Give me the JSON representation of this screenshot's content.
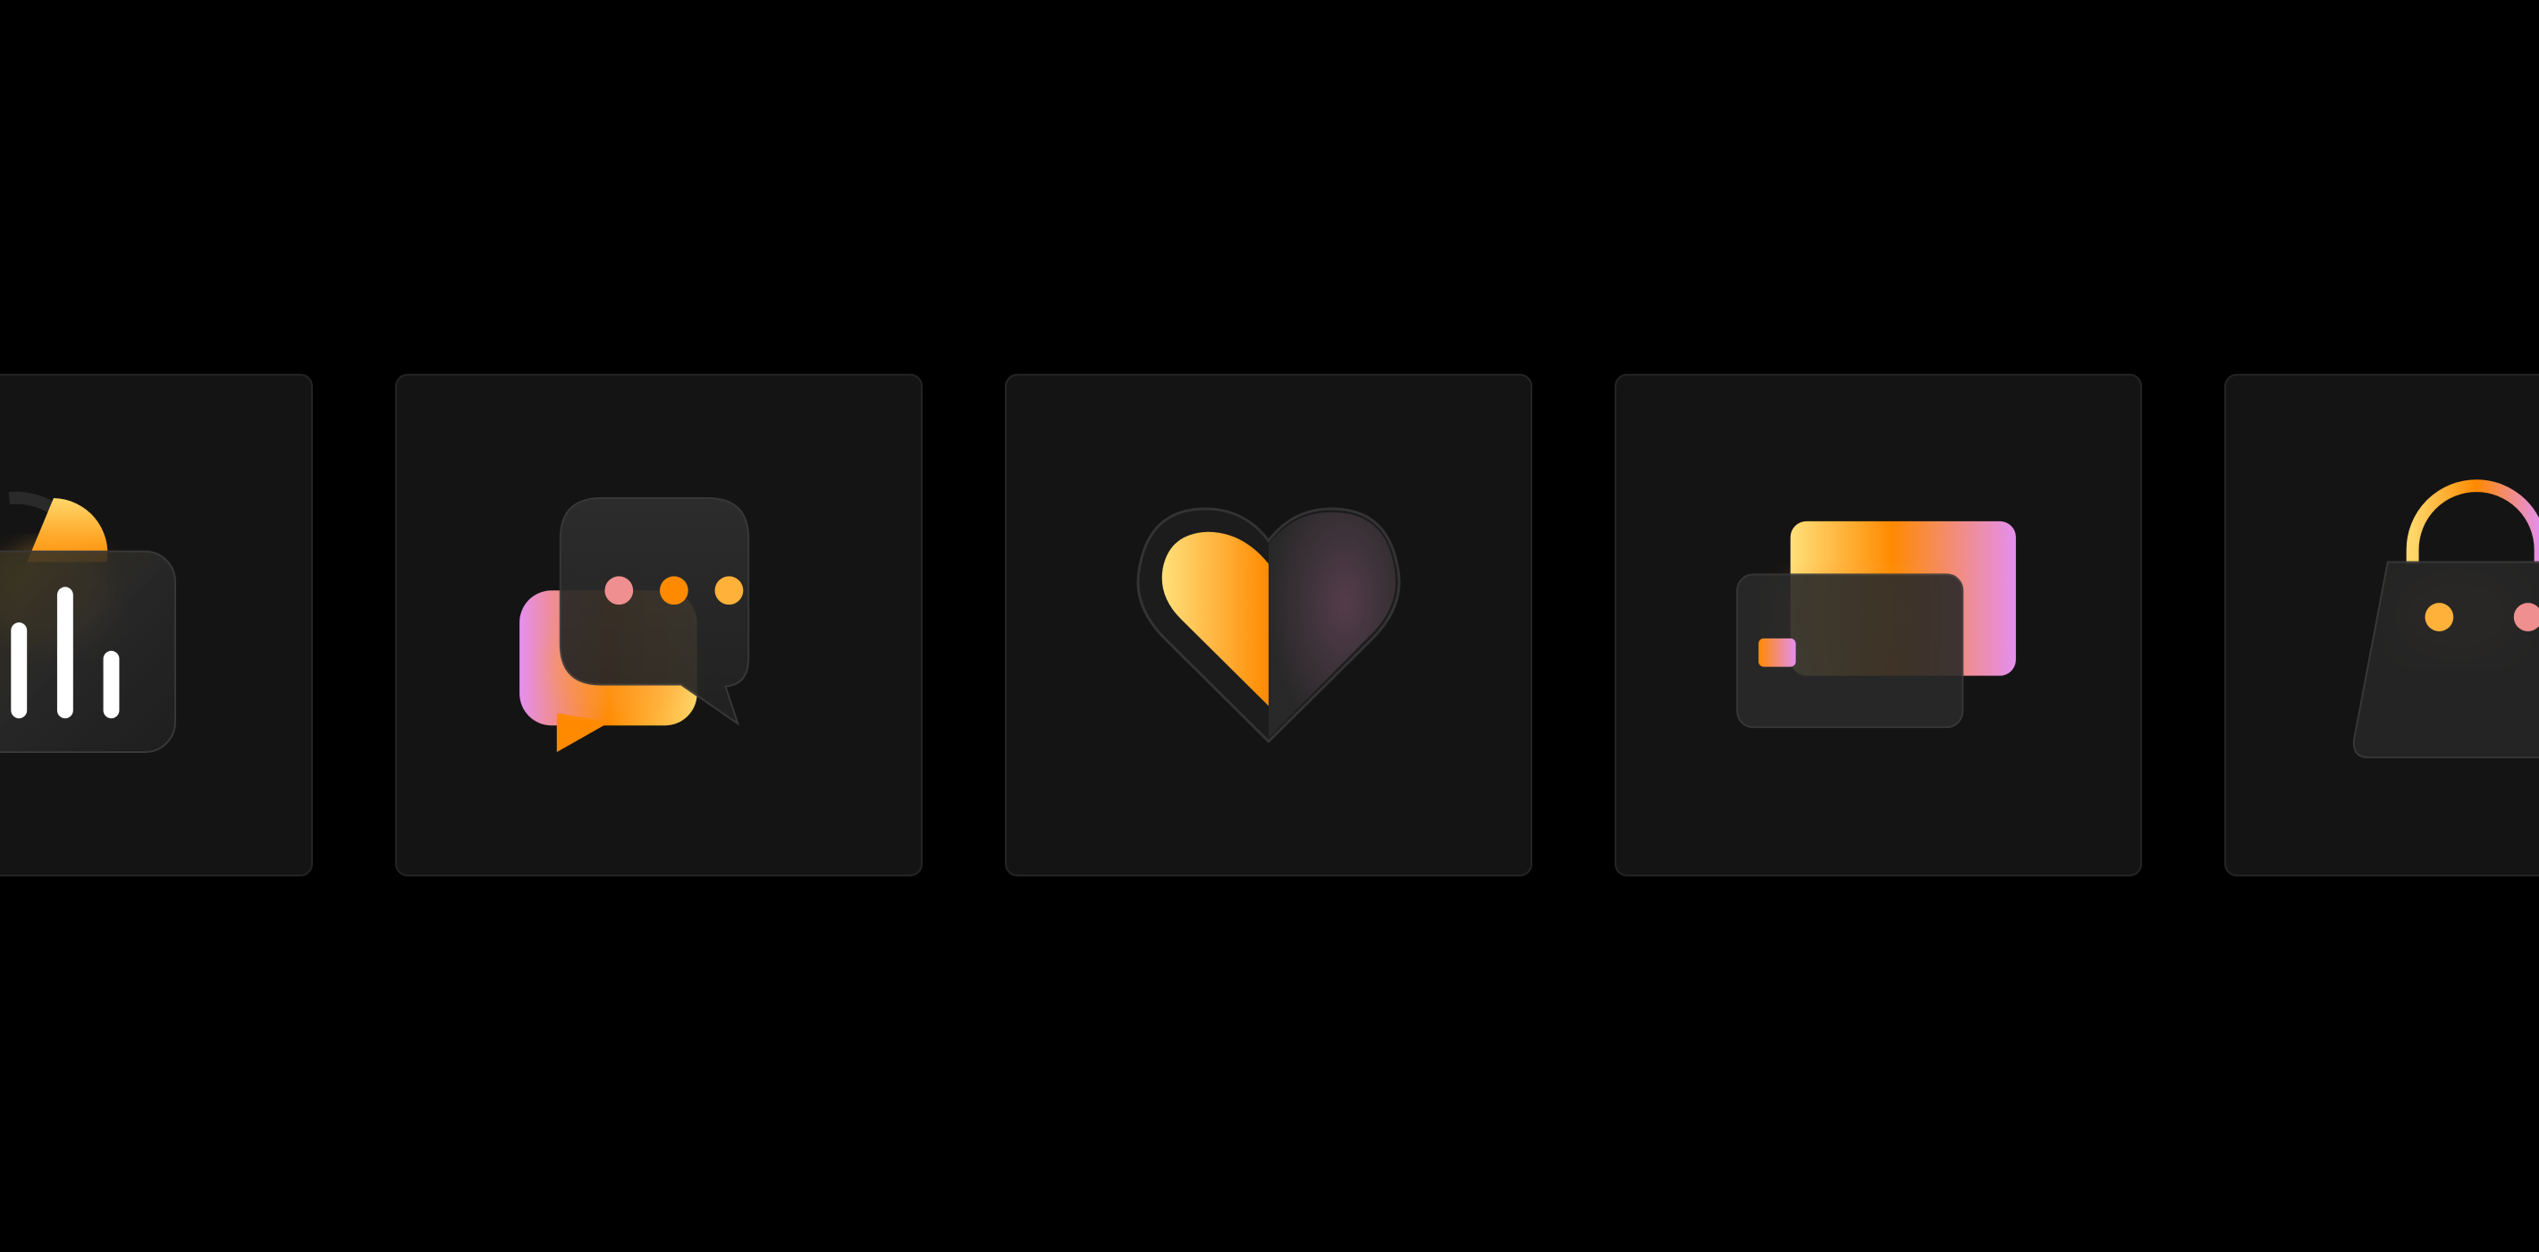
{
  "icons": [
    {
      "id": "analytics",
      "name": "bar-chart-pie-icon"
    },
    {
      "id": "chat",
      "name": "chat-bubbles-icon"
    },
    {
      "id": "favorite",
      "name": "heart-icon"
    },
    {
      "id": "payment",
      "name": "credit-cards-icon"
    },
    {
      "id": "shopping",
      "name": "shopping-bag-icon"
    }
  ],
  "colors": {
    "background": "#000000",
    "tile": "#141414",
    "tile_border": "#242424",
    "glass": "#2a2a2a",
    "yellow": "#ffd76a",
    "orange": "#ff8a00",
    "pink": "#e58ff0",
    "salmon": "#f08f8f",
    "white": "#ffffff"
  }
}
